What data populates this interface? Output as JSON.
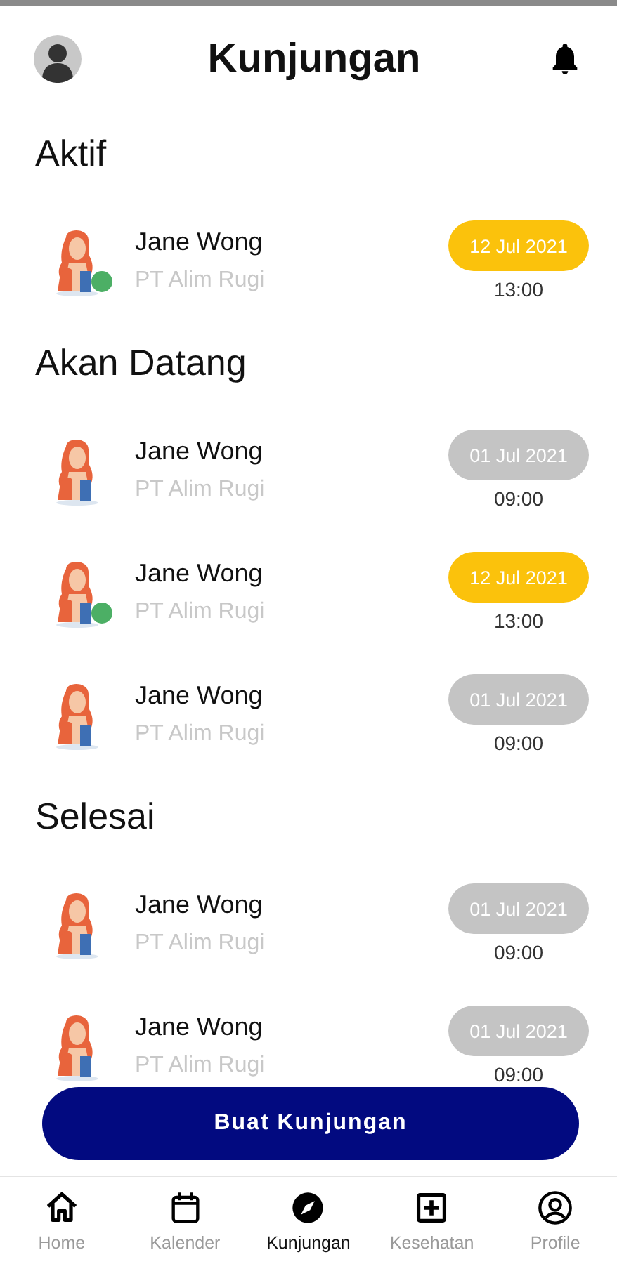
{
  "header": {
    "title": "Kunjungan"
  },
  "sections": [
    {
      "title": "Aktif",
      "visits": [
        {
          "name": "Jane Wong",
          "company": "PT Alim Rugi",
          "online": true,
          "date": "12 Jul 2021",
          "color": "#fbc20c",
          "time": "13:00"
        }
      ]
    },
    {
      "title": "Akan Datang",
      "visits": [
        {
          "name": "Jane Wong",
          "company": "PT Alim Rugi",
          "online": false,
          "date": "01 Jul 2021",
          "color": "#c4c4c4",
          "time": "09:00"
        },
        {
          "name": "Jane Wong",
          "company": "PT Alim Rugi",
          "online": true,
          "date": "12 Jul 2021",
          "color": "#fbc20c",
          "time": "13:00"
        },
        {
          "name": "Jane Wong",
          "company": "PT Alim Rugi",
          "online": false,
          "date": "01 Jul 2021",
          "color": "#c4c4c4",
          "time": "09:00"
        }
      ]
    },
    {
      "title": "Selesai",
      "visits": [
        {
          "name": "Jane Wong",
          "company": "PT Alim Rugi",
          "online": false,
          "date": "01 Jul 2021",
          "color": "#c4c4c4",
          "time": "09:00"
        },
        {
          "name": "Jane Wong",
          "company": "PT Alim Rugi",
          "online": false,
          "date": "01 Jul 2021",
          "color": "#c4c4c4",
          "time": "09:00"
        }
      ]
    }
  ],
  "primary_button": "Buat Kunjungan",
  "nav": [
    {
      "kind": "home",
      "label": "Home",
      "selected": false
    },
    {
      "kind": "calendar",
      "label": "Kalender",
      "selected": false
    },
    {
      "kind": "compass",
      "label": "Kunjungan",
      "selected": true
    },
    {
      "kind": "health",
      "label": "Kesehatan",
      "selected": false
    },
    {
      "kind": "profile",
      "label": "Profile",
      "selected": false
    }
  ]
}
